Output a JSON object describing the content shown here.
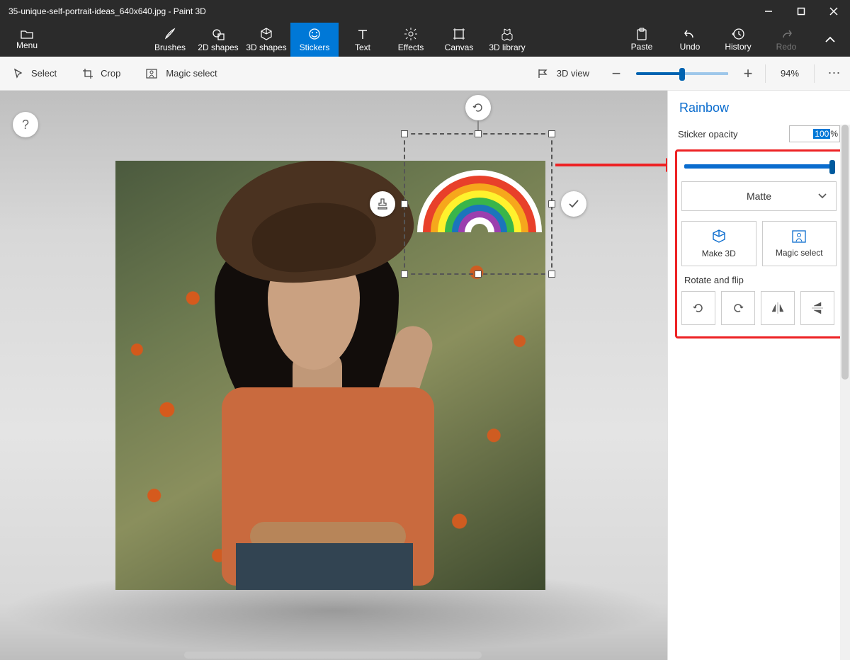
{
  "titlebar": {
    "title": "35-unique-self-portrait-ideas_640x640.jpg - Paint 3D"
  },
  "ribbon": {
    "menu": "Menu",
    "tools": {
      "brushes": "Brushes",
      "shapes2d": "2D shapes",
      "shapes3d": "3D shapes",
      "stickers": "Stickers",
      "text": "Text",
      "effects": "Effects",
      "canvas": "Canvas",
      "library3d": "3D library"
    },
    "right": {
      "paste": "Paste",
      "undo": "Undo",
      "history": "History",
      "redo": "Redo"
    }
  },
  "subbar": {
    "select": "Select",
    "crop": "Crop",
    "magic_select": "Magic select",
    "view3d": "3D view",
    "zoom_percent": "94%",
    "zoom_value": 47
  },
  "panel": {
    "title": "Rainbow",
    "opacity_label": "Sticker opacity",
    "opacity_value": "100",
    "opacity_unit": "%",
    "finish": "Matte",
    "make3d": "Make 3D",
    "magic_select": "Magic select",
    "rotate_flip": "Rotate and flip"
  },
  "help": "?"
}
